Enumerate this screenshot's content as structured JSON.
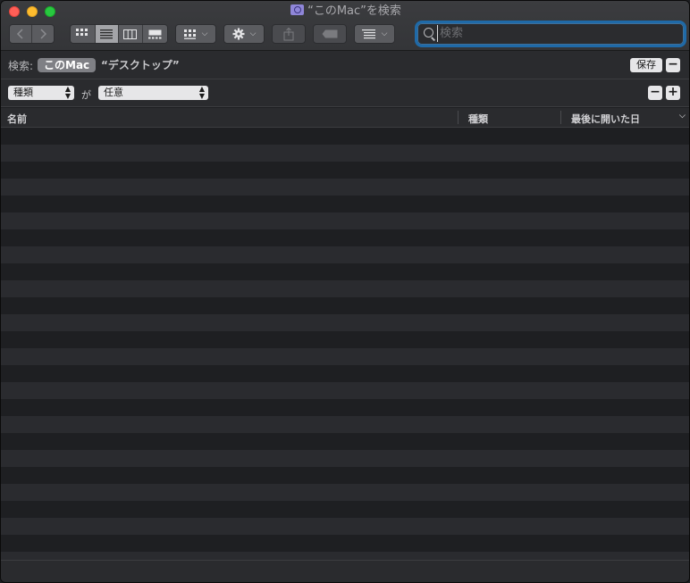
{
  "window": {
    "title": "“このMac”を検索",
    "search_placeholder": "検索",
    "search_value": ""
  },
  "icons": {
    "back": "chevron-left-icon",
    "forward": "chevron-right-icon",
    "view_icon": "icon-view-icon",
    "view_list": "list-view-icon",
    "view_column": "column-view-icon",
    "view_gallery": "gallery-view-icon",
    "group": "group-icon",
    "action": "gear-icon",
    "share": "share-icon",
    "tag": "tag-icon",
    "arrange": "arrange-icon",
    "search": "search-icon"
  },
  "scopebar": {
    "label": "検索:",
    "this_mac": "このMac",
    "desktop": "“デスクトップ”",
    "save": "保存",
    "remove": "−"
  },
  "criteria": {
    "attribute": "種類",
    "connector": "が",
    "value": "任意",
    "remove": "−",
    "add": "+"
  },
  "columns": {
    "name": "名前",
    "kind": "種類",
    "last_opened": "最後に開いた日"
  },
  "colors": {
    "accent": "#1f6aa8",
    "close": "#ff5f57",
    "minimize": "#febc2e",
    "maximize": "#28c840"
  }
}
